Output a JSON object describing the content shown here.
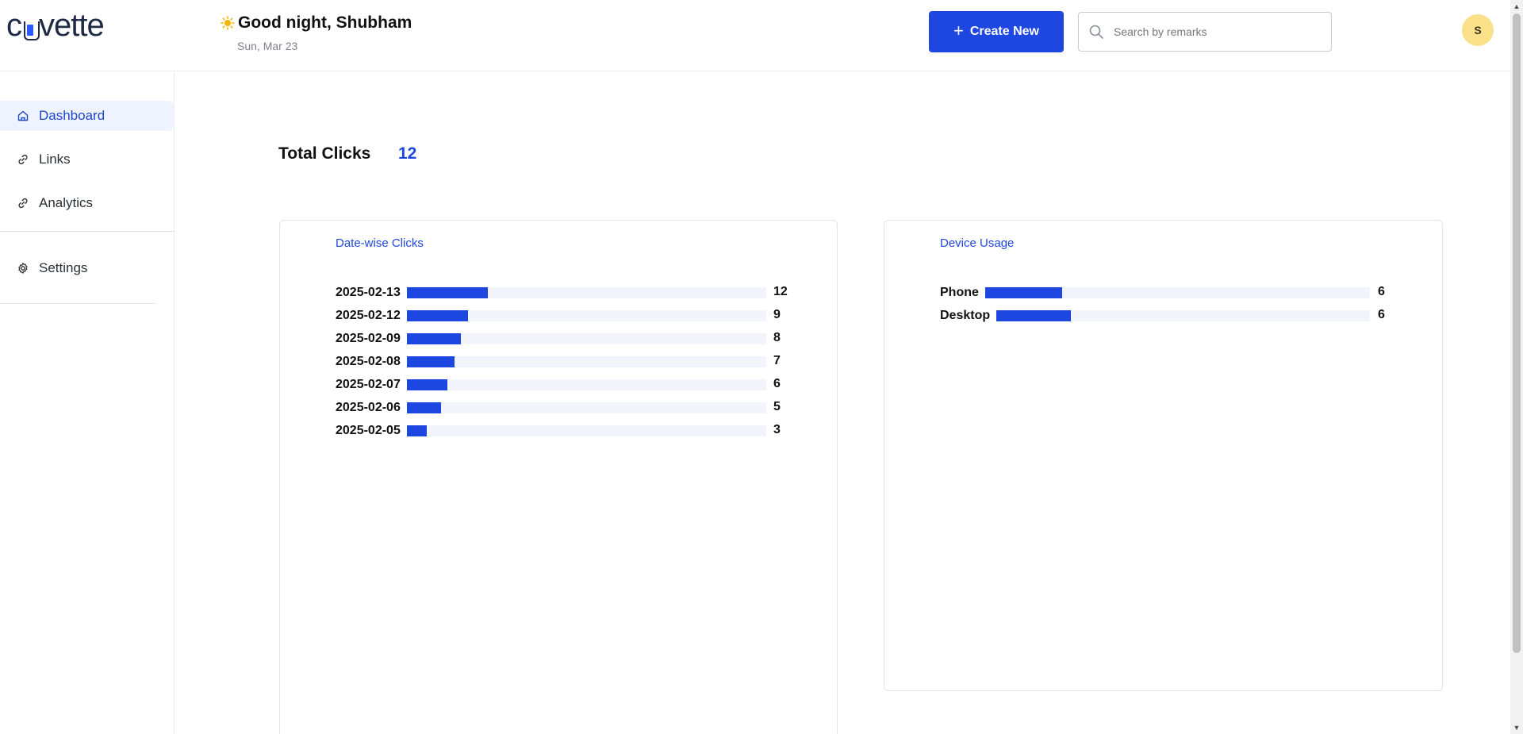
{
  "header": {
    "logo_left": "c",
    "logo_right": "vette",
    "greeting": "Good night, Shubham",
    "date": "Sun, Mar 23",
    "create_label": "Create New",
    "search_placeholder": "Search by remarks",
    "avatar_initial": "S"
  },
  "sidebar": {
    "items": [
      {
        "label": "Dashboard",
        "icon": "home-icon",
        "active": true
      },
      {
        "label": "Links",
        "icon": "link-icon",
        "active": false
      },
      {
        "label": "Analytics",
        "icon": "link-icon",
        "active": false
      },
      {
        "label": "Settings",
        "icon": "gear-icon",
        "active": false
      }
    ]
  },
  "main": {
    "total_label": "Total Clicks",
    "total_value": "12"
  },
  "colors": {
    "accent": "#1d47e0",
    "track": "#f1f4fb",
    "avatar_bg": "#fbe08a"
  },
  "chart_data": [
    {
      "type": "bar",
      "orientation": "horizontal",
      "title": "Date-wise Clicks",
      "categories": [
        "2025-02-13",
        "2025-02-12",
        "2025-02-09",
        "2025-02-08",
        "2025-02-07",
        "2025-02-06",
        "2025-02-05"
      ],
      "values": [
        12,
        9,
        8,
        7,
        6,
        5,
        3
      ],
      "value_scale_max": 53
    },
    {
      "type": "bar",
      "orientation": "horizontal",
      "title": "Device Usage",
      "categories": [
        "Phone",
        "Desktop"
      ],
      "values": [
        6,
        6
      ],
      "value_scale_max": 30
    }
  ]
}
